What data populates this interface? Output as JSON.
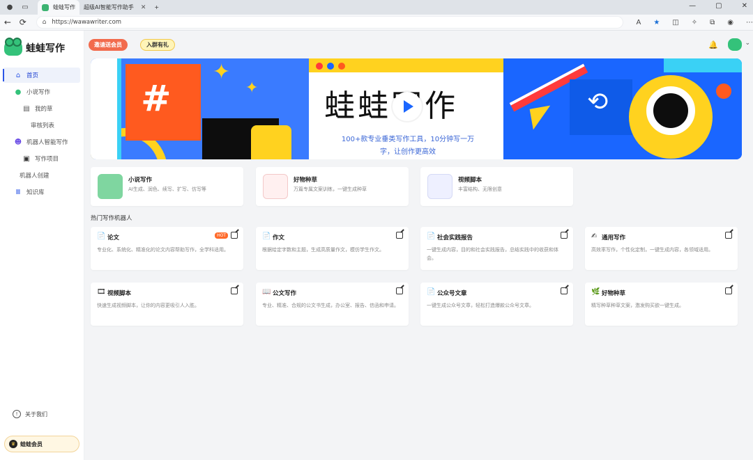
{
  "browser": {
    "tabs": [
      {
        "label": "蛙蛙写作",
        "active": true
      },
      {
        "label": "超级AI智能写作助手",
        "active": false
      }
    ],
    "url": "https://wawawriter.com"
  },
  "sidebar": {
    "brand": "蛙蛙写作",
    "items": [
      {
        "label": "首页",
        "icon": "home-icon",
        "level": 0,
        "active": true
      },
      {
        "label": "小说写作",
        "icon": "frog-icon",
        "level": 0
      },
      {
        "label": "我的草",
        "icon": "doc-icon",
        "level": 1
      },
      {
        "label": "审核列表",
        "icon": "",
        "level": 2
      },
      {
        "label": "机器人智能写作",
        "icon": "robot-icon",
        "level": 0
      },
      {
        "label": "写作项目",
        "icon": "box-icon",
        "level": 1
      },
      {
        "label": "机器人创建",
        "icon": "",
        "level": 0
      },
      {
        "label": "知识库",
        "icon": "library-icon",
        "level": 0
      }
    ],
    "about": "关于我们",
    "member": "蛙蛙会员"
  },
  "topbar": {
    "invite": "邀请送会员",
    "group": "入群有礼"
  },
  "banner": {
    "headline": "蛙蛙写作",
    "tagline_line1": "100+款专业垂类写作工具，10分钟写一万",
    "tagline_line2": "字，让创作更高效"
  },
  "features": [
    {
      "title": "小说写作",
      "desc": "AI生成、润色、续写、扩写、仿写等",
      "color": "#7fd6a0"
    },
    {
      "title": "好物种草",
      "desc": "万篇专属文案训练，一键生成种草",
      "color": "#ffe6e6"
    },
    {
      "title": "视频脚本",
      "desc": "丰富结构、无限创意",
      "color": "#eef0ff"
    }
  ],
  "section_title": "热门写作机器人",
  "robots": [
    {
      "title": "论文",
      "icon": "📄",
      "desc": "专业化、系统化、精准化的论文内容帮助写作，全学科适用。",
      "hot": "HOT"
    },
    {
      "title": "作文",
      "icon": "📄",
      "desc": "根据给定字数和主题，生成高质量作文，模仿学生作文。"
    },
    {
      "title": "社会实践报告",
      "icon": "📄",
      "desc": "一键生成内容，目的和社会实践报告，总结实践中的收获和体会。"
    },
    {
      "title": "通用写作",
      "icon": "✍",
      "desc": "高效率写作，个性化定制，一键生成内容，各领域适用。"
    },
    {
      "title": "视频脚本",
      "icon": "🎞",
      "desc": "快速生成视频脚本，让你的内容更吸引人入胜。"
    },
    {
      "title": "公文写作",
      "icon": "📖",
      "desc": "专业、精准、合规的公文书生成，办公室、报告、信函和申请。"
    },
    {
      "title": "公众号文章",
      "icon": "📄",
      "desc": "一键生成公众号文章，轻松打造爆款公众号文章。"
    },
    {
      "title": "好物种草",
      "icon": "🌿",
      "desc": "精写种草种草文案，激发购买欲一键生成。"
    }
  ]
}
